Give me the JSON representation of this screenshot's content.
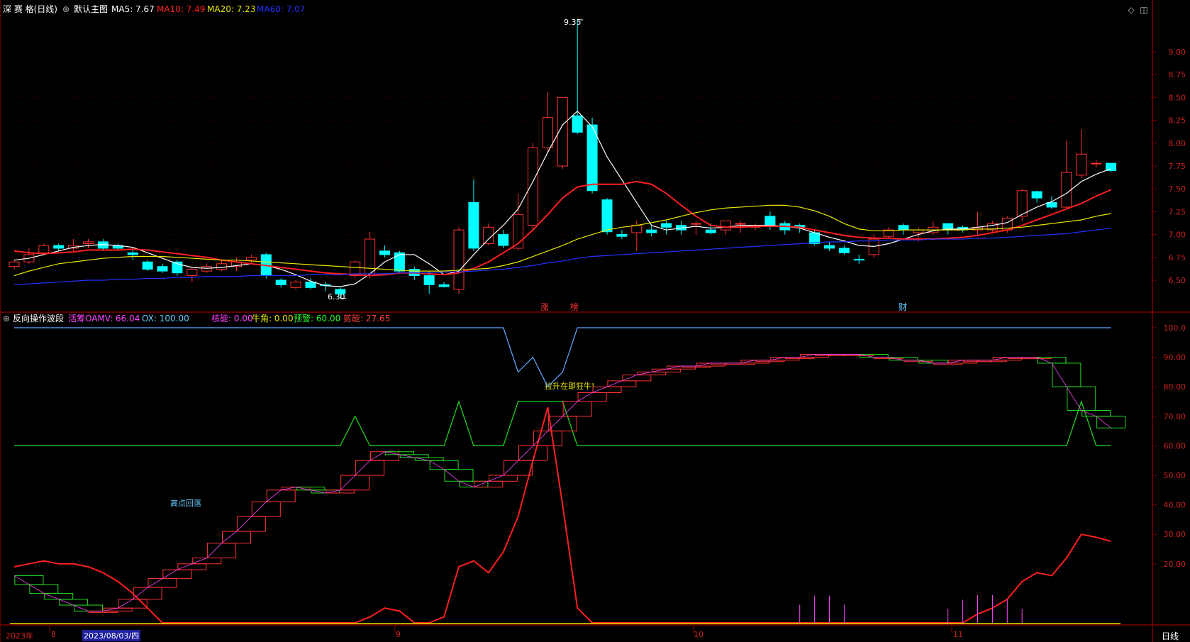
{
  "colors": {
    "up": "#ff3333",
    "down": "#00ffff",
    "ma5": "#ffffff",
    "ma10": "#ff2020",
    "ma20": "#e8e800",
    "ma60": "#2233ff",
    "grid": "#800000"
  },
  "main_header": {
    "stock_name": "深 赛 格(日线)",
    "chart_mode": "默认主图",
    "ma5_label": "MA5: 7.67",
    "ma10_label": "MA10: 7.49",
    "ma20_label": "MA20: 7.23",
    "ma60_label": "MA60: 7.07"
  },
  "sub_header": {
    "indicator_name": "反向操作波段",
    "oamv_label": "活筹OAMV: 66.04",
    "ox_label": "OX: 100.00",
    "hexin_label": "核能: 0.00",
    "niujiao_label": "牛角: 0.00",
    "yujing_label": "预警: 60.00",
    "jianneng_label": "剪能: 27.65"
  },
  "annotations": {
    "high_price": "9.35",
    "low_price": "6.30",
    "signal_zhang": "涨",
    "signal_bang": "榜",
    "signal_cai": "财",
    "pull_up_text": "拉升在即狂牛!",
    "high_fall_text": "高点回落"
  },
  "bottom_bar": {
    "year_label": "2023年",
    "month_8": "8",
    "selected_date": "2023/08/03/四",
    "month_9": "9",
    "month_10": "10",
    "month_11": "11",
    "timeframe": "日线"
  },
  "chart_data": [
    {
      "type": "candlestick",
      "axis": "price",
      "ylim": [
        6.3,
        9.35
      ],
      "y_ticks": [
        "9.00",
        "8.75",
        "8.50",
        "8.25",
        "8.00",
        "7.75",
        "7.50",
        "7.25",
        "7.00",
        "6.75",
        "6.50"
      ],
      "candles": [
        [
          6.65,
          6.7,
          6.62,
          6.72
        ],
        [
          6.7,
          6.78,
          6.68,
          6.85
        ],
        [
          6.8,
          6.88,
          6.78,
          6.9
        ],
        [
          6.88,
          6.85,
          6.82,
          6.9
        ],
        [
          6.85,
          6.88,
          6.82,
          6.95
        ],
        [
          6.9,
          6.92,
          6.85,
          6.95
        ],
        [
          6.92,
          6.85,
          6.82,
          6.95
        ],
        [
          6.88,
          6.85,
          6.82,
          6.9
        ],
        [
          6.8,
          6.78,
          6.72,
          6.85
        ],
        [
          6.7,
          6.62,
          6.6,
          6.72
        ],
        [
          6.65,
          6.6,
          6.58,
          6.68
        ],
        [
          6.7,
          6.58,
          6.55,
          6.72
        ],
        [
          6.55,
          6.62,
          6.48,
          6.65
        ],
        [
          6.6,
          6.65,
          6.58,
          6.68
        ],
        [
          6.62,
          6.68,
          6.6,
          6.72
        ],
        [
          6.65,
          6.7,
          6.6,
          6.75
        ],
        [
          6.72,
          6.75,
          6.68,
          6.78
        ],
        [
          6.78,
          6.55,
          6.52,
          6.8
        ],
        [
          6.5,
          6.45,
          6.42,
          6.52
        ],
        [
          6.42,
          6.48,
          6.4,
          6.5
        ],
        [
          6.48,
          6.42,
          6.4,
          6.52
        ],
        [
          6.45,
          6.44,
          6.38,
          6.48
        ],
        [
          6.4,
          6.35,
          6.3,
          6.42
        ],
        [
          6.55,
          6.7,
          6.52,
          6.72
        ],
        [
          6.55,
          6.95,
          6.52,
          7.03
        ],
        [
          6.82,
          6.78,
          6.75,
          6.88
        ],
        [
          6.8,
          6.6,
          6.58,
          6.82
        ],
        [
          6.62,
          6.55,
          6.5,
          6.65
        ],
        [
          6.55,
          6.45,
          6.35,
          6.6
        ],
        [
          6.45,
          6.43,
          6.42,
          6.48
        ],
        [
          6.4,
          7.05,
          6.35,
          7.08
        ],
        [
          7.35,
          6.85,
          6.82,
          7.6
        ],
        [
          6.9,
          7.08,
          6.88,
          7.12
        ],
        [
          7.0,
          6.88,
          6.85,
          7.05
        ],
        [
          6.85,
          7.22,
          6.82,
          7.45
        ],
        [
          7.1,
          7.95,
          7.05,
          8.0
        ],
        [
          7.95,
          8.28,
          7.9,
          8.56
        ],
        [
          7.75,
          8.5,
          7.72,
          8.5
        ],
        [
          8.3,
          8.12,
          8.1,
          9.35
        ],
        [
          8.2,
          7.48,
          7.45,
          8.28
        ],
        [
          7.38,
          7.03,
          7.0,
          7.4
        ],
        [
          7.0,
          6.98,
          6.95,
          7.05
        ],
        [
          7.02,
          7.1,
          6.82,
          7.15
        ],
        [
          7.05,
          7.02,
          6.98,
          7.1
        ],
        [
          7.12,
          7.08,
          7.0,
          7.15
        ],
        [
          7.1,
          7.05,
          7.0,
          7.15
        ],
        [
          7.12,
          7.12,
          7.0,
          7.15
        ],
        [
          7.05,
          7.02,
          7.0,
          7.12
        ],
        [
          7.05,
          7.15,
          7.0,
          7.15
        ],
        [
          7.12,
          7.12,
          7.02,
          7.15
        ],
        [
          7.08,
          7.1,
          7.05,
          7.12
        ],
        [
          7.2,
          7.1,
          7.05,
          7.25
        ],
        [
          7.12,
          7.05,
          7.0,
          7.15
        ],
        [
          7.1,
          7.08,
          7.02,
          7.12
        ],
        [
          7.02,
          6.9,
          6.88,
          7.05
        ],
        [
          6.88,
          6.85,
          6.82,
          6.92
        ],
        [
          6.85,
          6.8,
          6.78,
          6.88
        ],
        [
          6.73,
          6.72,
          6.68,
          6.78
        ],
        [
          6.78,
          6.95,
          6.75,
          7.0
        ],
        [
          6.98,
          7.05,
          6.95,
          7.08
        ],
        [
          7.1,
          7.05,
          7.0,
          7.12
        ],
        [
          7.02,
          7.05,
          6.92,
          7.08
        ],
        [
          7.02,
          7.08,
          7.0,
          7.15
        ],
        [
          7.12,
          7.05,
          7.0,
          7.12
        ],
        [
          7.08,
          7.05,
          7.02,
          7.1
        ],
        [
          7.05,
          7.08,
          6.98,
          7.25
        ],
        [
          7.05,
          7.12,
          7.02,
          7.15
        ],
        [
          7.05,
          7.18,
          7.02,
          7.2
        ],
        [
          7.2,
          7.48,
          7.15,
          7.5
        ],
        [
          7.47,
          7.4,
          7.35,
          7.48
        ],
        [
          7.35,
          7.3,
          7.28,
          7.42
        ],
        [
          7.3,
          7.68,
          7.28,
          8.03
        ],
        [
          7.65,
          7.88,
          7.62,
          8.15
        ],
        [
          7.78,
          7.78,
          7.73,
          7.82
        ],
        [
          7.78,
          7.7,
          7.68,
          7.78
        ]
      ],
      "series": [
        {
          "name": "MA5",
          "values": [
            6.72,
            6.74,
            6.78,
            6.82,
            6.86,
            6.88,
            6.89,
            6.88,
            6.86,
            6.8,
            6.74,
            6.68,
            6.64,
            6.63,
            6.64,
            6.66,
            6.68,
            6.66,
            6.62,
            6.56,
            6.49,
            6.44,
            6.43,
            6.46,
            6.57,
            6.7,
            6.78,
            6.78,
            6.68,
            6.56,
            6.6,
            6.78,
            6.95,
            7.1,
            7.28,
            7.58,
            7.9,
            8.2,
            8.35,
            8.18,
            7.85,
            7.6,
            7.35,
            7.1,
            7.05,
            7.07,
            7.09,
            7.07,
            7.08,
            7.1,
            7.1,
            7.1,
            7.09,
            7.07,
            7.02,
            6.97,
            6.93,
            6.88,
            6.87,
            6.9,
            6.95,
            7.0,
            7.04,
            7.06,
            7.06,
            7.08,
            7.1,
            7.13,
            7.22,
            7.3,
            7.36,
            7.45,
            7.58,
            7.66,
            7.72
          ]
        },
        {
          "name": "MA10",
          "values": [
            6.82,
            6.8,
            6.79,
            6.8,
            6.81,
            6.83,
            6.83,
            6.83,
            6.84,
            6.83,
            6.81,
            6.79,
            6.77,
            6.75,
            6.72,
            6.7,
            6.68,
            6.66,
            6.64,
            6.62,
            6.6,
            6.58,
            6.57,
            6.56,
            6.55,
            6.56,
            6.58,
            6.58,
            6.57,
            6.56,
            6.58,
            6.63,
            6.7,
            6.8,
            6.9,
            7.05,
            7.22,
            7.4,
            7.52,
            7.55,
            7.55,
            7.55,
            7.58,
            7.55,
            7.45,
            7.32,
            7.2,
            7.1,
            7.08,
            7.08,
            7.09,
            7.09,
            7.09,
            7.08,
            7.05,
            7.02,
            6.99,
            6.97,
            6.96,
            6.96,
            6.95,
            6.95,
            6.95,
            6.96,
            6.97,
            6.99,
            7.02,
            7.05,
            7.1,
            7.16,
            7.22,
            7.28,
            7.34,
            7.42,
            7.49
          ]
        },
        {
          "name": "MA20",
          "values": [
            6.55,
            6.6,
            6.64,
            6.68,
            6.7,
            6.72,
            6.74,
            6.75,
            6.76,
            6.76,
            6.76,
            6.75,
            6.74,
            6.73,
            6.72,
            6.72,
            6.71,
            6.7,
            6.69,
            6.68,
            6.67,
            6.66,
            6.65,
            6.64,
            6.63,
            6.62,
            6.61,
            6.6,
            6.6,
            6.6,
            6.61,
            6.62,
            6.63,
            6.66,
            6.7,
            6.76,
            6.82,
            6.88,
            6.95,
            7.0,
            7.05,
            7.08,
            7.1,
            7.13,
            7.16,
            7.2,
            7.24,
            7.27,
            7.29,
            7.3,
            7.31,
            7.32,
            7.32,
            7.3,
            7.26,
            7.2,
            7.12,
            7.06,
            7.04,
            7.04,
            7.05,
            7.05,
            7.05,
            7.05,
            7.05,
            7.06,
            7.06,
            7.07,
            7.08,
            7.1,
            7.12,
            7.14,
            7.16,
            7.2,
            7.23
          ]
        },
        {
          "name": "MA60",
          "values": [
            6.45,
            6.46,
            6.47,
            6.48,
            6.49,
            6.5,
            6.5,
            6.51,
            6.51,
            6.52,
            6.52,
            6.53,
            6.53,
            6.54,
            6.54,
            6.54,
            6.55,
            6.55,
            6.55,
            6.55,
            6.56,
            6.56,
            6.56,
            6.57,
            6.57,
            6.57,
            6.58,
            6.58,
            6.58,
            6.59,
            6.59,
            6.6,
            6.61,
            6.62,
            6.64,
            6.66,
            6.69,
            6.71,
            6.74,
            6.76,
            6.77,
            6.78,
            6.79,
            6.8,
            6.81,
            6.82,
            6.83,
            6.84,
            6.85,
            6.86,
            6.87,
            6.88,
            6.89,
            6.9,
            6.91,
            6.92,
            6.92,
            6.93,
            6.93,
            6.94,
            6.94,
            6.94,
            6.95,
            6.95,
            6.95,
            6.96,
            6.96,
            6.97,
            6.98,
            6.99,
            7.0,
            7.01,
            7.03,
            7.05,
            7.07
          ]
        }
      ]
    },
    {
      "type": "line",
      "axis": "indicator",
      "ylim": [
        0,
        100
      ],
      "y_ticks": [
        "100.0",
        "90.00",
        "80.00",
        "70.00",
        "60.00",
        "50.00",
        "40.00",
        "30.00",
        "20.00"
      ],
      "series": [
        {
          "name": "OX",
          "values": [
            100,
            100,
            100,
            100,
            100,
            100,
            100,
            100,
            100,
            100,
            100,
            100,
            100,
            100,
            100,
            100,
            100,
            100,
            100,
            100,
            100,
            100,
            100,
            100,
            100,
            100,
            100,
            100,
            100,
            100,
            100,
            100,
            100,
            100,
            85,
            90,
            80,
            85,
            100,
            100,
            100,
            100,
            100,
            100,
            100,
            100,
            100,
            100,
            100,
            100,
            100,
            100,
            100,
            100,
            100,
            100,
            100,
            100,
            100,
            100,
            100,
            100,
            100,
            100,
            100,
            100,
            100,
            100,
            100,
            100,
            100,
            100,
            100,
            100,
            100
          ]
        },
        {
          "name": "预警",
          "values": [
            60,
            60,
            60,
            60,
            60,
            60,
            60,
            60,
            60,
            60,
            60,
            60,
            60,
            60,
            60,
            60,
            60,
            60,
            60,
            60,
            60,
            60,
            60,
            70,
            60,
            60,
            60,
            60,
            60,
            60,
            75,
            60,
            60,
            60,
            75,
            75,
            75,
            75,
            60,
            60,
            60,
            60,
            60,
            60,
            60,
            60,
            60,
            60,
            60,
            60,
            60,
            60,
            60,
            60,
            60,
            60,
            60,
            60,
            60,
            60,
            60,
            60,
            60,
            60,
            60,
            60,
            60,
            60,
            60,
            60,
            60,
            60,
            75,
            60,
            60
          ]
        },
        {
          "name": "剪能",
          "values": [
            19,
            20,
            21,
            20,
            20,
            19,
            17,
            14,
            10,
            5,
            0,
            0,
            0,
            0,
            0,
            0,
            0,
            0,
            0,
            0,
            0,
            0,
            0,
            0,
            2,
            5,
            4,
            0,
            0,
            2,
            19,
            21,
            17,
            24,
            36,
            55,
            73,
            40,
            5,
            0,
            0,
            0,
            0,
            0,
            0,
            0,
            0,
            0,
            0,
            0,
            0,
            0,
            0,
            0,
            0,
            0,
            0,
            0,
            0,
            0,
            0,
            0,
            0,
            0,
            0,
            3,
            5,
            8,
            14,
            17,
            16,
            22,
            30,
            29,
            27.65
          ]
        },
        {
          "name": "活筹OAMV",
          "values": [
            16,
            13,
            10,
            8,
            6,
            4,
            4,
            5,
            8,
            12,
            15,
            18,
            20,
            22,
            27,
            31,
            36,
            41,
            45,
            46,
            45,
            44,
            45,
            50,
            55,
            58,
            57,
            56,
            55,
            52,
            48,
            46,
            48,
            50,
            55,
            60,
            65,
            70,
            75,
            78,
            80,
            82,
            84,
            85,
            86,
            87,
            87,
            88,
            88,
            88,
            89,
            89,
            90,
            90,
            91,
            91,
            91,
            91,
            90,
            90,
            89,
            89,
            88,
            88,
            89,
            89,
            89,
            90,
            90,
            90,
            88,
            80,
            72,
            70,
            66.04
          ]
        }
      ]
    }
  ]
}
